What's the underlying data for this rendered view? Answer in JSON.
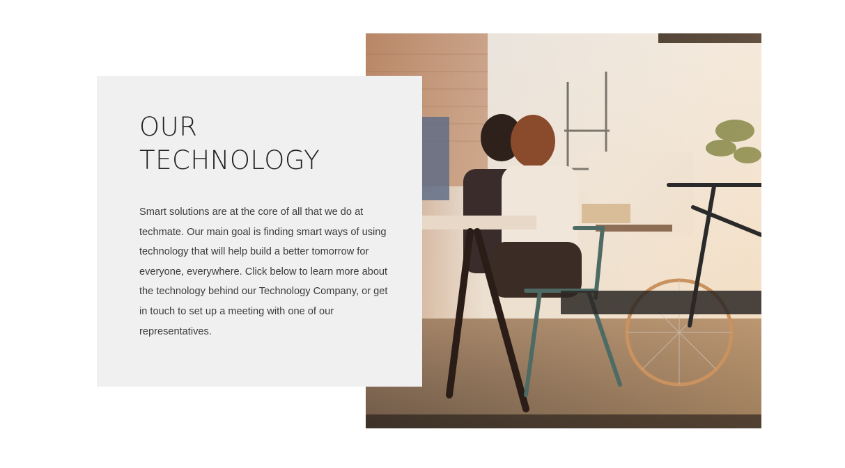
{
  "section": {
    "title_line1": "OUR",
    "title_line2": "TECHNOLOGY",
    "body": "Smart solutions are at the core of all that we do at techmate. Our main goal is finding smart ways of using technology that will help build a better tomorrow for everyone, everywhere. Click below to learn more about the technology behind our Technology Company, or get in touch to set up a meeting with one of our representatives."
  },
  "colors": {
    "page_background": "#ffffff",
    "card_background": "#f0f0f0",
    "title_text": "#1e1e1e",
    "body_text": "#3b3b3b"
  }
}
